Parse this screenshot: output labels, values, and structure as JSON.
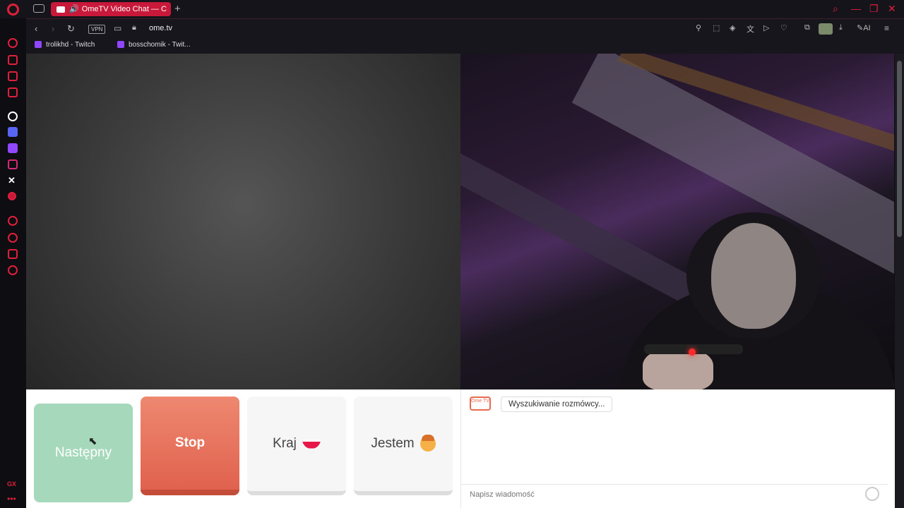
{
  "tab": {
    "title": "OmeTV Video Chat — C"
  },
  "toolbar": {
    "vpn": "VPN",
    "url": "ome.tv",
    "ai": "AI"
  },
  "bookmarks": [
    {
      "label": "trolikhd - Twitch"
    },
    {
      "label": "bosschomik - Twit..."
    }
  ],
  "controls": {
    "next": "Następny",
    "stop": "Stop",
    "country": "Kraj",
    "gender": "Jestem"
  },
  "chat": {
    "logo": "Ome TV",
    "status": "Wyszukiwanie rozmówcy...",
    "placeholder": "Napisz wiadomość"
  },
  "sidebar": {
    "bottom": "GX"
  },
  "colors": {
    "accent": "#e0203a",
    "next": "#a6d9bb",
    "stop": "#e0624e"
  }
}
